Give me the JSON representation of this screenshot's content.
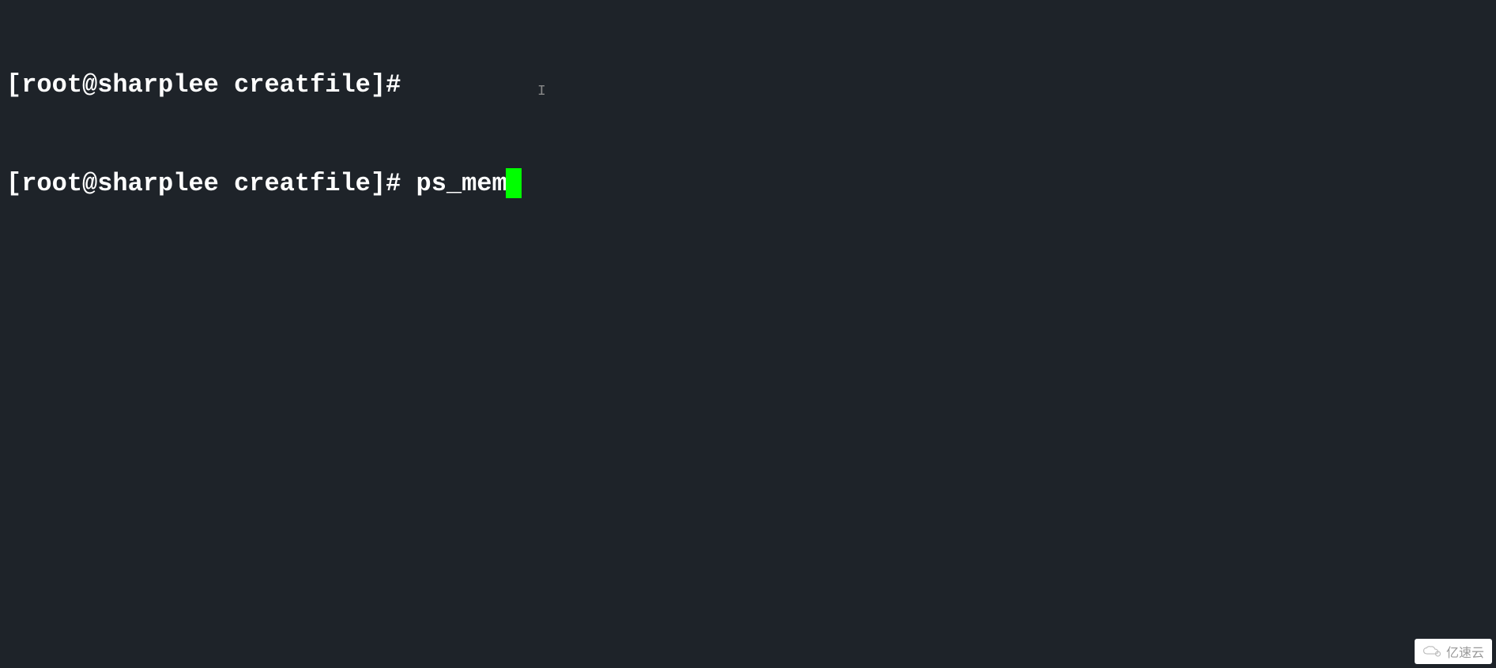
{
  "terminal": {
    "lines": [
      {
        "prompt": "[root@sharplee creatfile]# ",
        "command": ""
      },
      {
        "prompt": "[root@sharplee creatfile]# ",
        "command": "ps_mem"
      }
    ]
  },
  "watermark": {
    "text": "亿速云"
  }
}
